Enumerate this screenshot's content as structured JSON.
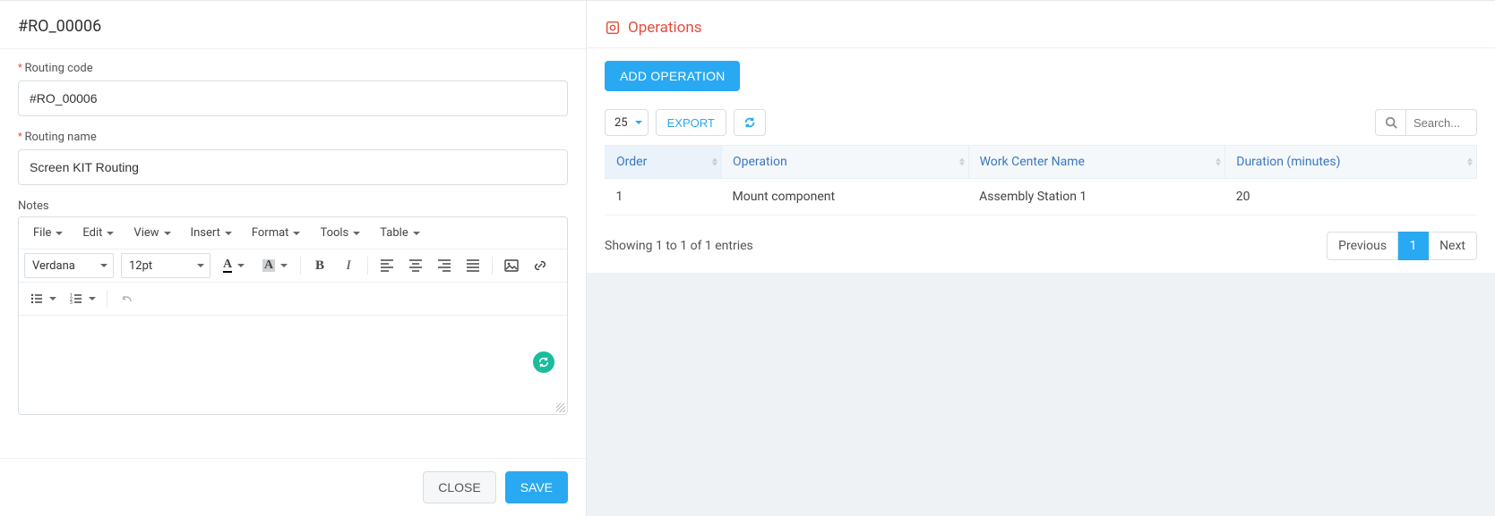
{
  "page": {
    "title": "#RO_00006"
  },
  "form": {
    "routing_code": {
      "label": "Routing code",
      "value": "#RO_00006"
    },
    "routing_name": {
      "label": "Routing name",
      "value": "Screen KIT Routing"
    },
    "notes_label": "Notes"
  },
  "rte": {
    "menus": {
      "file": "File",
      "edit": "Edit",
      "view": "View",
      "insert": "Insert",
      "format": "Format",
      "tools": "Tools",
      "table": "Table"
    },
    "font_family": "Verdana",
    "font_size": "12pt"
  },
  "actions": {
    "close": "CLOSE",
    "save": "SAVE"
  },
  "operations": {
    "header": "Operations",
    "add_button": "ADD OPERATION",
    "page_size": "25",
    "export_label": "EXPORT",
    "search_placeholder": "Search...",
    "columns": {
      "order": "Order",
      "operation": "Operation",
      "work_center": "Work Center Name",
      "duration": "Duration (minutes)"
    },
    "rows": [
      {
        "order": "1",
        "operation": "Mount component",
        "work_center": "Assembly Station 1",
        "duration": "20"
      }
    ],
    "info": "Showing 1 to 1 of 1 entries",
    "pager": {
      "prev": "Previous",
      "current": "1",
      "next": "Next"
    }
  }
}
